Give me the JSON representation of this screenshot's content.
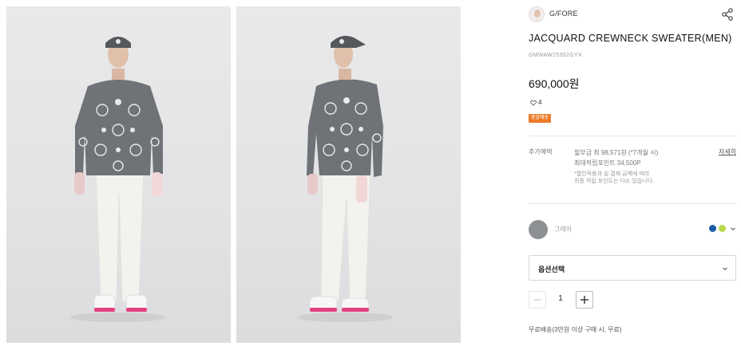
{
  "gallery": {
    "images": [
      {
        "name": "model-front",
        "pose": "front"
      },
      {
        "name": "model-three-quarter",
        "pose": "three-quarter"
      }
    ]
  },
  "brand": {
    "name": "G/FORE"
  },
  "product": {
    "title": "JACQUARD CREWNECK SWEATER(MEN)",
    "sku": "GMWAW25352GYX",
    "price": "690,000원",
    "likes": "4",
    "badge": "총알배송"
  },
  "benefits": {
    "label": "추가혜택",
    "lines": [
      "힐부금 최 98,571원 (*7개월 시)",
      "최대적립포인트 34,500P"
    ],
    "note": [
      "*할인적용과 실 결제 금액에 따라",
      "최종 적립 포인트는 다소 있습니다."
    ],
    "detail_link": "자세히"
  },
  "color": {
    "selected_name": "그레이",
    "options": [
      {
        "name": "navy",
        "hex": "#1f5aa8"
      },
      {
        "name": "lime",
        "hex": "#b6d84a"
      }
    ],
    "swatch_hex": "#8d9093"
  },
  "option_select": {
    "placeholder": "옵션선택"
  },
  "quantity": {
    "value": "1"
  },
  "shipping": {
    "text": "무료배송(3만원 이상 구매 시, 무료)"
  },
  "icons": [
    "share-icon",
    "heart-icon",
    "chevron-down-icon",
    "minus-icon",
    "plus-icon"
  ]
}
